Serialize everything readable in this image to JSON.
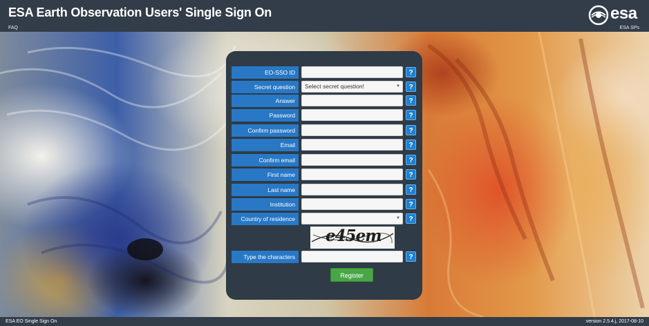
{
  "header": {
    "title": "ESA Earth Observation Users' Single Sign On",
    "faq_link": "FAQ",
    "logo_text": "esa",
    "sps_link": "ESA SPs"
  },
  "form": {
    "fields": [
      {
        "label": "EO-SSO ID",
        "type": "text",
        "value": ""
      },
      {
        "label": "Secret question",
        "type": "select",
        "value": "Select secret question!"
      },
      {
        "label": "Answer",
        "type": "text",
        "value": ""
      },
      {
        "label": "Password",
        "type": "password",
        "value": ""
      },
      {
        "label": "Confirm password",
        "type": "password",
        "value": ""
      },
      {
        "label": "Email",
        "type": "text",
        "value": ""
      },
      {
        "label": "Confirm email",
        "type": "text",
        "value": ""
      },
      {
        "label": "First name",
        "type": "text",
        "value": ""
      },
      {
        "label": "Last name",
        "type": "text",
        "value": ""
      },
      {
        "label": "Institution",
        "type": "text",
        "value": ""
      },
      {
        "label": "Country of residence",
        "type": "select",
        "value": ""
      }
    ],
    "captcha_text": "e45em",
    "captcha_field": {
      "label": "Type the characters",
      "value": ""
    },
    "help_glyph": "?",
    "register_label": "Register"
  },
  "footer": {
    "left": "ESA EO Single Sign On",
    "right": "version 2.5.4.j, 2017-08-10"
  },
  "colors": {
    "header_bg": "#333d49",
    "panel_bg": "#2f3b47",
    "label_bg": "#2878c6",
    "help_bg": "#1e80d0",
    "register_bg": "#49a647"
  }
}
